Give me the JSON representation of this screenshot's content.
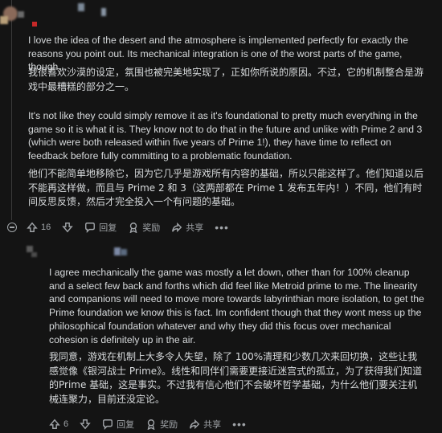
{
  "comment": {
    "en_paragraph_1": "I love the idea of the desert and the atmosphere is implemented perfectly for exactly the reasons you point out. Its mechanical integration is one of the worst parts of the game, though.",
    "zh_paragraph_1": "我很喜欢沙漠的设定，氛围也被完美地实现了，正如你所说的原因。不过，它的机制整合是游戏中最糟糕的部分之一。",
    "en_paragraph_2": "It's not like they could simply remove it as it's foundational to pretty much everything in the game so it is what it is. They know not to do that in the future and unlike with Prime 2 and 3 (which were both released within five years of Prime 1!), they have time to reflect on feedback before fully committing to a problematic foundation.",
    "zh_paragraph_2": "他们不能简单地移除它，因为它几乎是游戏所有内容的基础，所以只能这样了。他们知道以后不能再这样做，而且与 Prime 2 和 3（这两部都在 Prime 1 发布五年内！）不同，他们有时间反思反馈，然后才完全投入一个有问题的基础。",
    "actions": {
      "vote_count": "16",
      "reply_label": "回复",
      "award_label": "奖励",
      "share_label": "共享"
    }
  },
  "reply": {
    "en_paragraph": "I agree mechanically the game was mostly a let down, other than for 100% cleanup and a select few back and forths which did feel like Metroid prime to me. The linearity and companions will need to move more towards labyrinthian more isolation, to get the Prime foundation we know this is fact. Im confident though that they wont mess up the philosophical foundation whatever and why they did this focus over mechanical cohesion is definitely up in the air.",
    "zh_paragraph": "我同意，游戏在机制上大多令人失望，除了 100%清理和少数几次来回切换，这些让我感觉像《银河战士 Prime》。线性和同伴们需要更接近迷宫式的孤立，为了获得我们知道的Prime 基础，这是事实。不过我有信心他们不会破坏哲学基础，为什么他们要关注机械连聚力，目前还没定论。",
    "actions": {
      "vote_count": "6",
      "reply_label": "回复",
      "award_label": "奖励",
      "share_label": "共享"
    }
  }
}
